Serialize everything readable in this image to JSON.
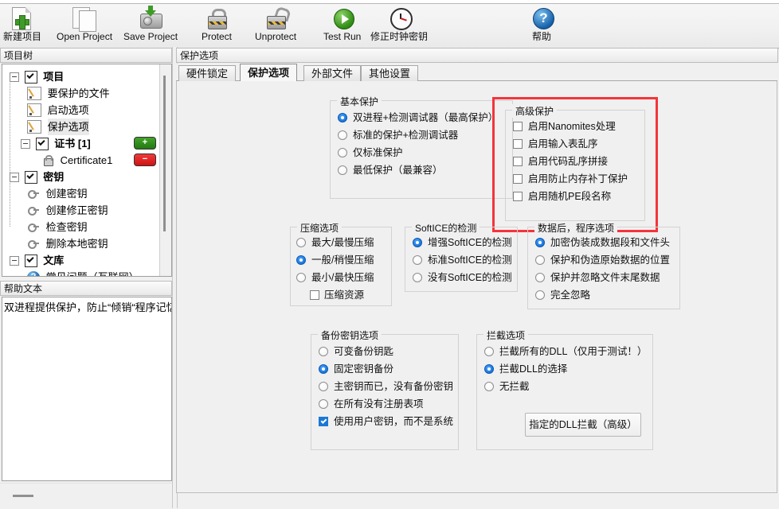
{
  "toolbar": {
    "buttons": [
      {
        "label": "新建项目",
        "icon": "new-project-icon"
      },
      {
        "label": "Open Project",
        "icon": "open-project-icon"
      },
      {
        "label": "Save Project",
        "icon": "save-project-icon"
      },
      {
        "label": "Protect",
        "icon": "lock-closed-icon"
      },
      {
        "label": "Unprotect",
        "icon": "lock-open-icon"
      },
      {
        "label": "Test Run",
        "icon": "play-icon"
      },
      {
        "label": "修正时钟密钥",
        "icon": "clock-icon"
      },
      {
        "label": "帮助",
        "icon": "help-question-icon"
      }
    ]
  },
  "left_panel": {
    "tree_title": "项目树",
    "help_title": "帮助文本",
    "help_text": "双进程提供保护，防止“倾销“程序记忆体",
    "tree": [
      {
        "label": "项目",
        "level": 0,
        "type": "checkbox-node",
        "checked": true,
        "bold": true,
        "expanded": true
      },
      {
        "label": "要保护的文件",
        "level": 1,
        "type": "doc",
        "selected": false
      },
      {
        "label": "启动选项",
        "level": 1,
        "type": "doc",
        "selected": false
      },
      {
        "label": "保护选项",
        "level": 1,
        "type": "doc",
        "selected": true
      },
      {
        "label": "证书 [1]",
        "level": 1,
        "type": "checkbox-node",
        "checked": true,
        "bold": true,
        "expanded": true,
        "button": "add"
      },
      {
        "label": "Certificate1",
        "level": 2,
        "type": "lock",
        "button": "remove"
      },
      {
        "label": "密钥",
        "level": 0,
        "type": "checkbox-node",
        "checked": true,
        "bold": true,
        "expanded": true
      },
      {
        "label": "创建密钥",
        "level": 1,
        "type": "key"
      },
      {
        "label": "创建修正密钥",
        "level": 1,
        "type": "key"
      },
      {
        "label": "检查密钥",
        "level": 1,
        "type": "key"
      },
      {
        "label": "删除本地密钥",
        "level": 1,
        "type": "key"
      },
      {
        "label": "文库",
        "level": 0,
        "type": "checkbox-node",
        "checked": true,
        "bold": true,
        "expanded": true
      },
      {
        "label": "常见问题（互联网）",
        "level": 1,
        "type": "question"
      }
    ],
    "add_button_label": "+",
    "remove_button_label": "−"
  },
  "main": {
    "title": "保护选项",
    "tabs": [
      {
        "label": "硬件锁定",
        "active": false
      },
      {
        "label": "保护选项",
        "active": true
      },
      {
        "label": "外部文件",
        "active": false
      },
      {
        "label": "其他设置",
        "active": false
      }
    ],
    "groups": {
      "basic": {
        "title": "基本保护",
        "options": [
          {
            "label": "双进程+检测调试器（最高保护）",
            "selected": true
          },
          {
            "label": "标准的保护+检测调试器",
            "selected": false
          },
          {
            "label": "仅标准保护",
            "selected": false
          },
          {
            "label": "最低保护（最兼容）",
            "selected": false
          }
        ]
      },
      "advanced": {
        "title": "高级保护",
        "highlighted": true,
        "highlight_color": "#f5343a",
        "options": [
          {
            "label": "启用Nanomites处理",
            "checked": false
          },
          {
            "label": "启用输入表乱序",
            "checked": false
          },
          {
            "label": "启用代码乱序拼接",
            "checked": false
          },
          {
            "label": "启用防止内存补丁保护",
            "checked": false
          },
          {
            "label": "启用随机PE段名称",
            "checked": false
          }
        ]
      },
      "compression": {
        "title": "压缩选项",
        "options": [
          {
            "label": "最大/最慢压缩",
            "selected": false
          },
          {
            "label": "一般/稍慢压缩",
            "selected": true
          },
          {
            "label": "最小/最快压缩",
            "selected": false
          }
        ],
        "extra_checkbox": {
          "label": "压缩资源",
          "checked": false
        }
      },
      "softice": {
        "title": "SoftICE的检测",
        "options": [
          {
            "label": "增强SoftICE的检测",
            "selected": true
          },
          {
            "label": "标准SoftICE的检测",
            "selected": false
          },
          {
            "label": "没有SoftICE的检测",
            "selected": false
          }
        ]
      },
      "data": {
        "title": "数据后，程序选项",
        "options": [
          {
            "label": "加密伪装成数据段和文件头",
            "selected": true
          },
          {
            "label": "保护和伪造原始数据的位置",
            "selected": false
          },
          {
            "label": "保护并忽略文件末尾数据",
            "selected": false
          },
          {
            "label": "完全忽略",
            "selected": false
          }
        ]
      },
      "backup_key": {
        "title": "备份密钥选项",
        "options": [
          {
            "label": "可变备份钥匙",
            "selected": false
          },
          {
            "label": "固定密钥备份",
            "selected": true
          },
          {
            "label": "主密钥而已，没有备份密钥",
            "selected": false
          },
          {
            "label": "在所有没有注册表项",
            "selected": false
          }
        ],
        "extra_checkbox": {
          "label": "使用用户密钥，而不是系统",
          "checked": true
        }
      },
      "intercept": {
        "title": "拦截选项",
        "options": [
          {
            "label": "拦截所有的DLL（仅用于测试！）",
            "selected": false
          },
          {
            "label": "拦截DLL的选择",
            "selected": true
          },
          {
            "label": "无拦截",
            "selected": false
          }
        ],
        "button_label": "指定的DLL拦截（高级）"
      }
    }
  }
}
